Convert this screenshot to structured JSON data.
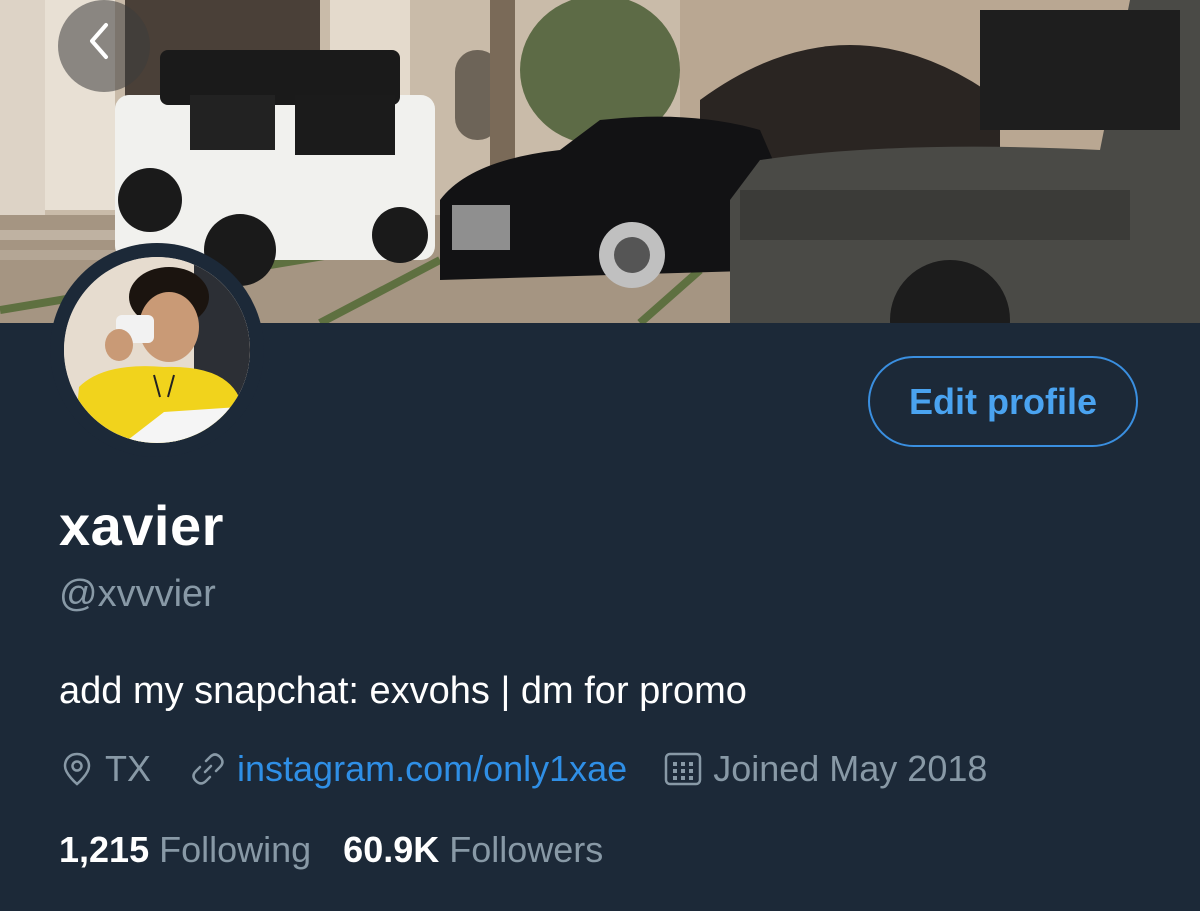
{
  "header": {
    "back_icon": "chevron-left-icon",
    "banner_image": "header-photo"
  },
  "profile": {
    "display_name": "xavier",
    "handle": "@xvvvier",
    "bio": "add my snapchat: exvohs | dm for promo",
    "edit_button_label": "Edit profile",
    "location": "TX",
    "location_icon": "location-pin-icon",
    "website": "instagram.com/only1xae",
    "website_icon": "link-icon",
    "joined": "Joined May 2018",
    "joined_icon": "calendar-icon"
  },
  "stats": {
    "following_count": "1,215",
    "following_label": "Following",
    "followers_count": "60.9K",
    "followers_label": "Followers"
  },
  "colors": {
    "background": "#1c2938",
    "accent": "#2f8fe6",
    "secondary_text": "#8899a6",
    "primary_text": "#ffffff"
  }
}
